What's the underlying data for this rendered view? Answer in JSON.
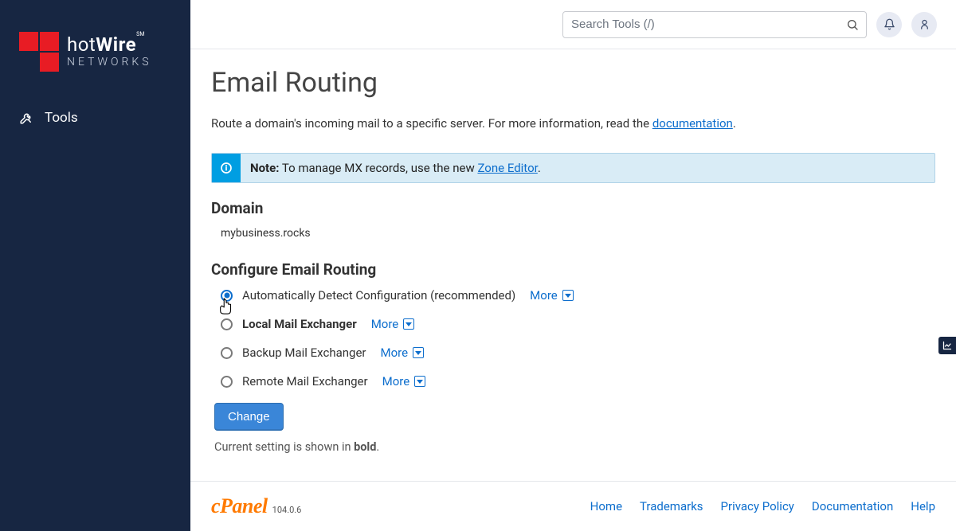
{
  "sidebar": {
    "brand_left": "hot",
    "brand_bold": "Wire",
    "brand_sm": "SM",
    "brand_sub": "NETWORKS",
    "tools_label": "Tools"
  },
  "topbar": {
    "search_placeholder": "Search Tools (/)"
  },
  "page": {
    "title": "Email Routing",
    "intro_pre": "Route a domain's incoming mail to a specific server. For more information, read the ",
    "intro_link": "documentation",
    "intro_post": "."
  },
  "info": {
    "note_label": "Note:",
    "note_text_pre": " To manage MX records, use the new ",
    "note_link": "Zone Editor",
    "note_text_post": "."
  },
  "domain": {
    "label": "Domain",
    "value": "mybusiness.rocks"
  },
  "config": {
    "label": "Configure Email Routing",
    "more_label": "More",
    "options": [
      {
        "label": "Automatically Detect Configuration (recommended)",
        "selected": true,
        "current": false
      },
      {
        "label": "Local Mail Exchanger",
        "selected": false,
        "current": true
      },
      {
        "label": "Backup Mail Exchanger",
        "selected": false,
        "current": false
      },
      {
        "label": "Remote Mail Exchanger",
        "selected": false,
        "current": false
      }
    ],
    "change_button": "Change",
    "hint_pre": "Current setting is shown in ",
    "hint_bold": "bold",
    "hint_post": "."
  },
  "footer": {
    "cpanel": "cPanel",
    "version": "104.0.6",
    "links": [
      "Home",
      "Trademarks",
      "Privacy Policy",
      "Documentation",
      "Help"
    ]
  }
}
